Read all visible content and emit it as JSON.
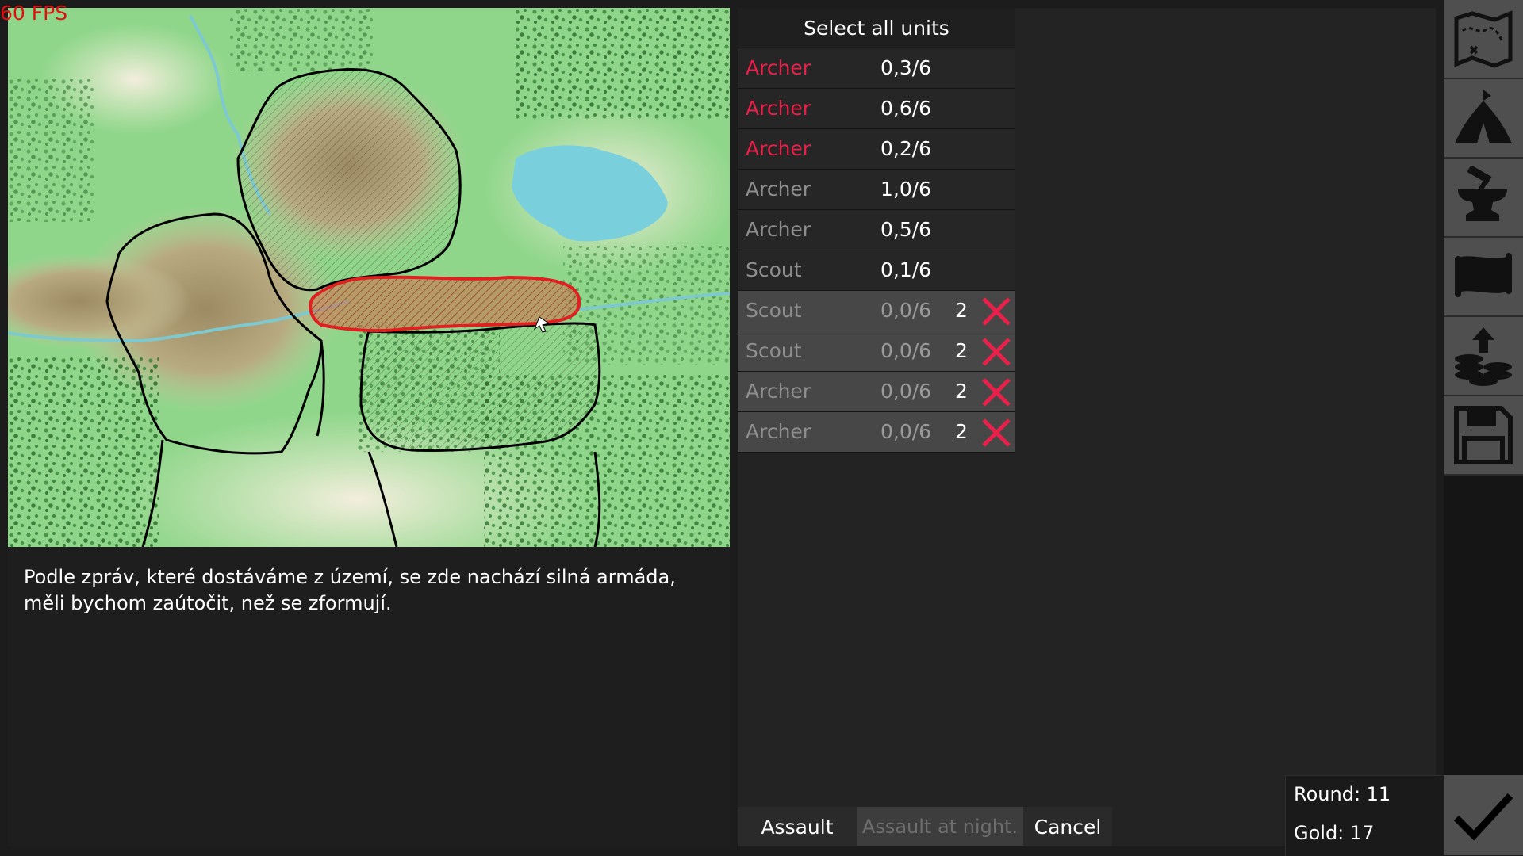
{
  "fps": "60 FPS",
  "description": "Podle zpráv, které dostáváme z území, se zde nachází silná armáda, měli bychom zaútočit, než se zformují.",
  "units": {
    "select_all": "Select all units",
    "rows": [
      {
        "name": "Archer",
        "value": "0,3/6",
        "name_color": "red",
        "waiting": false,
        "count": ""
      },
      {
        "name": "Archer",
        "value": "0,6/6",
        "name_color": "red",
        "waiting": false,
        "count": ""
      },
      {
        "name": "Archer",
        "value": "0,2/6",
        "name_color": "red",
        "waiting": false,
        "count": ""
      },
      {
        "name": "Archer",
        "value": "1,0/6",
        "name_color": "gray",
        "waiting": false,
        "count": ""
      },
      {
        "name": "Archer",
        "value": "0,5/6",
        "name_color": "gray",
        "waiting": false,
        "count": ""
      },
      {
        "name": "Scout",
        "value": "0,1/6",
        "name_color": "gray",
        "waiting": false,
        "count": ""
      },
      {
        "name": "Scout",
        "value": "0,0/6",
        "name_color": "gray",
        "waiting": true,
        "count": "2"
      },
      {
        "name": "Scout",
        "value": "0,0/6",
        "name_color": "gray",
        "waiting": true,
        "count": "2"
      },
      {
        "name": "Archer",
        "value": "0,0/6",
        "name_color": "gray",
        "waiting": true,
        "count": "2"
      },
      {
        "name": "Archer",
        "value": "0,0/6",
        "name_color": "gray",
        "waiting": true,
        "count": "2"
      }
    ]
  },
  "buttons": {
    "assault": "Assault",
    "assault_night": "Assault at night.",
    "cancel": "Cancel"
  },
  "status": {
    "round": "Round: 11",
    "gold": "Gold: 17"
  },
  "sidebar_icons": [
    "map-icon",
    "tent-icon",
    "anvil-icon",
    "scroll-icon",
    "coins-icon",
    "save-icon"
  ],
  "colors": {
    "accent_red": "#e8204a",
    "selected_region": "#e02020"
  }
}
